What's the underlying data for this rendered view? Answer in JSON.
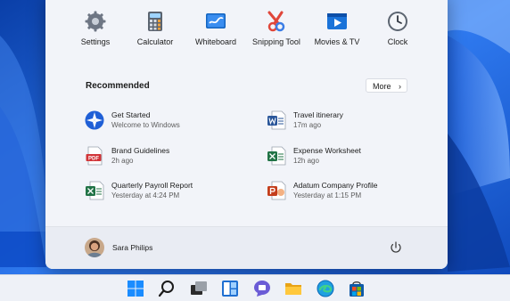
{
  "pinned": [
    {
      "label": "Settings",
      "icon": "gear-icon"
    },
    {
      "label": "Calculator",
      "icon": "calculator-icon"
    },
    {
      "label": "Whiteboard",
      "icon": "whiteboard-icon"
    },
    {
      "label": "Snipping Tool",
      "icon": "scissors-icon"
    },
    {
      "label": "Movies & TV",
      "icon": "play-icon"
    },
    {
      "label": "Clock",
      "icon": "clock-icon"
    }
  ],
  "recommended": {
    "title": "Recommended",
    "more_label": "More",
    "items": [
      {
        "name": "Get Started",
        "sub": "Welcome to Windows",
        "icon": "get-started-icon"
      },
      {
        "name": "Travel itinerary",
        "sub": "17m ago",
        "icon": "word-doc-icon"
      },
      {
        "name": "Brand Guidelines",
        "sub": "2h ago",
        "icon": "pdf-icon"
      },
      {
        "name": "Expense Worksheet",
        "sub": "12h ago",
        "icon": "excel-icon"
      },
      {
        "name": "Quarterly Payroll Report",
        "sub": "Yesterday at 4:24 PM",
        "icon": "excel-icon"
      },
      {
        "name": "Adatum Company Profile",
        "sub": "Yesterday at 1:15 PM",
        "icon": "powerpoint-icon"
      }
    ]
  },
  "user": {
    "name": "Sara Philips"
  },
  "taskbar": {
    "icons": [
      "windows-start-icon",
      "search-icon",
      "task-view-icon",
      "widgets-icon",
      "teams-chat-icon",
      "file-explorer-icon",
      "edge-icon",
      "store-icon"
    ]
  },
  "colors": {
    "accent": "#0f6cbd",
    "wallpaper": "#2f6fe0"
  }
}
